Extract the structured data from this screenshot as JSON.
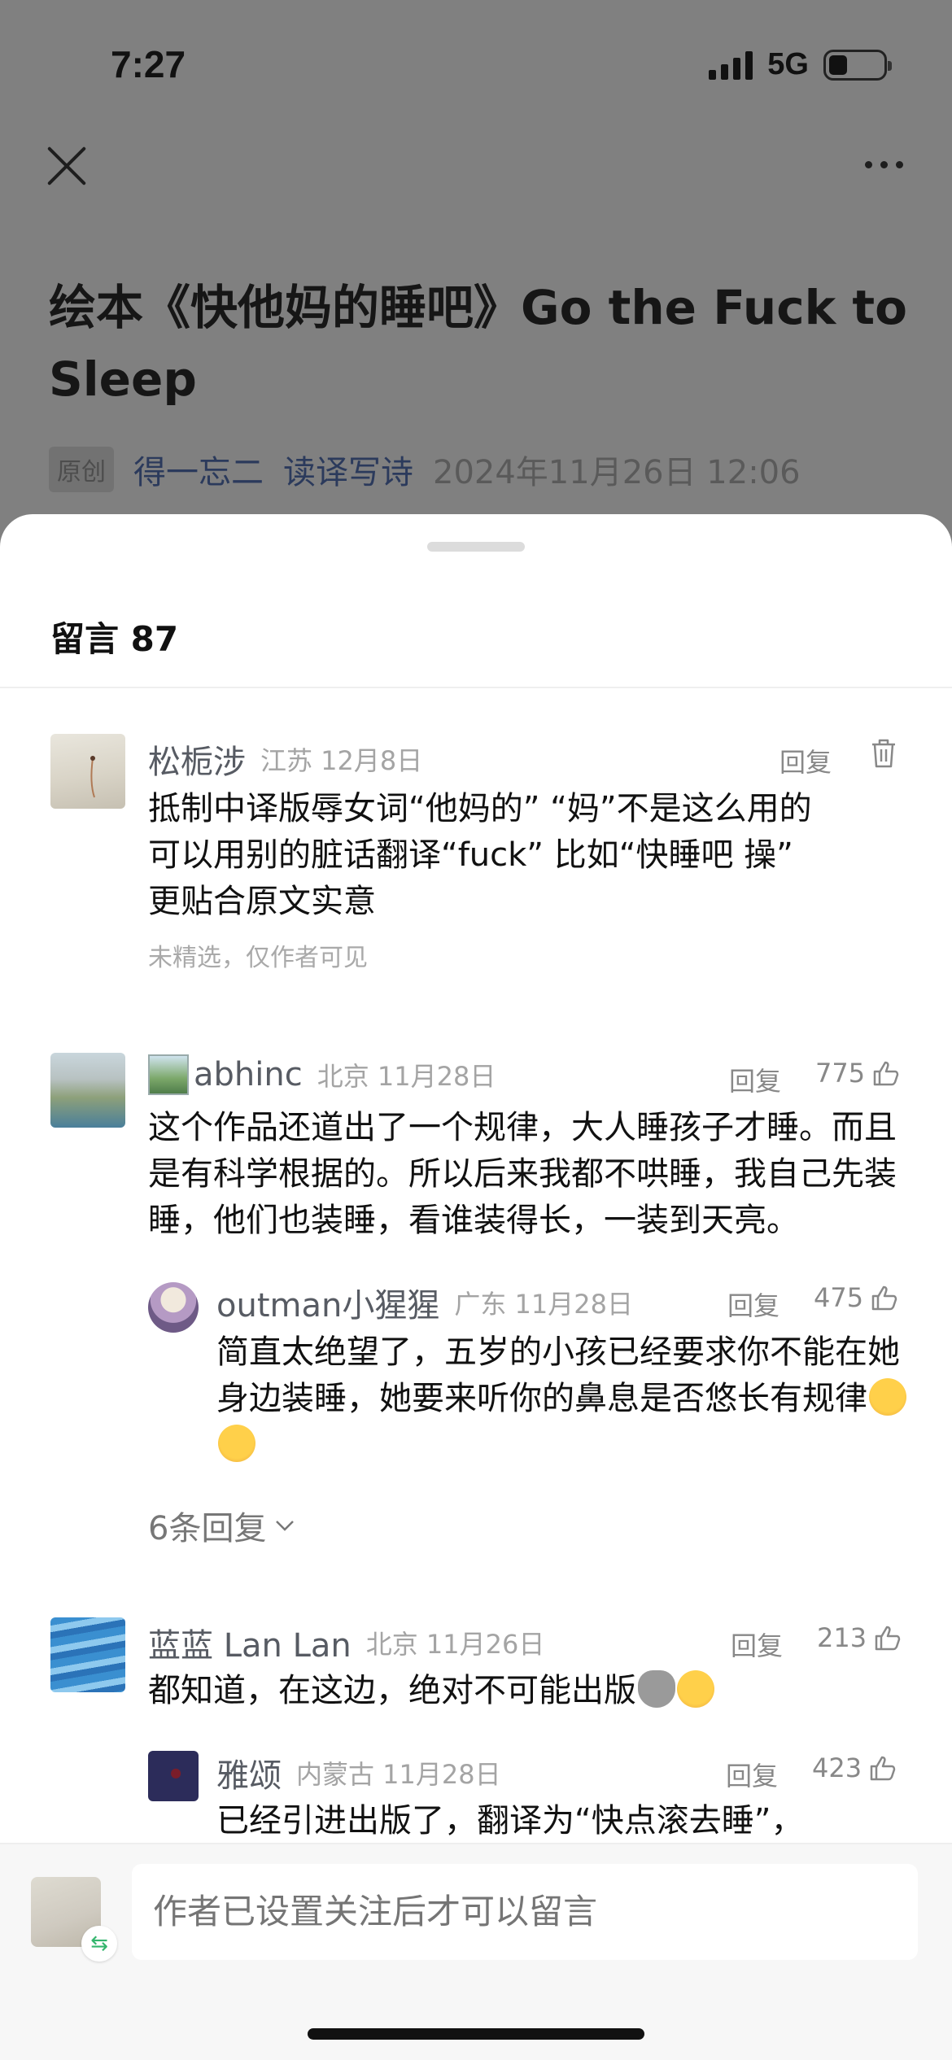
{
  "status_bar": {
    "time": "7:27",
    "network": "5G"
  },
  "article": {
    "title": "绘本《快他妈的睡吧》Go the Fuck to Sleep",
    "badge": "原创",
    "author": "得一忘二",
    "column": "读译写诗",
    "date": "2024年11月26日 12:06"
  },
  "comments_sheet": {
    "header": "留言 87",
    "comments": [
      {
        "name": "松栀涉",
        "location": "江苏 12月8日",
        "reply_label": "回复",
        "text": "抵制中译版辱女词“他妈的” “妈”不是这么用的  可以用别的脏话翻译“fuck” 比如“快睡吧 操” 更贴合原文实意",
        "note": "未精选，仅作者可见"
      },
      {
        "name": "abhinc",
        "location": "北京 11月28日",
        "reply_label": "回复",
        "likes": "775",
        "text": "这个作品还道出了一个规律，大人睡孩子才睡。而且是有科学根据的。所以后来我都不哄睡，我自己先装睡，他们也装睡，看谁装得长，一装到天亮。",
        "reply": {
          "name": "outman小猩猩",
          "location": "广东 11月28日",
          "reply_label": "回复",
          "likes": "475",
          "text": "简直太绝望了，五岁的小孩已经要求你不能在她身边装睡，她要来听你的鼻息是否悠长有规律"
        },
        "more_replies": "6条回复"
      },
      {
        "name": "蓝蓝 Lan Lan",
        "location": "北京 11月26日",
        "reply_label": "回复",
        "likes": "213",
        "text": "都知道，在这边，绝对不可能出版",
        "reply": {
          "name": "雅颂",
          "location": "内蒙古 11月28日",
          "reply_label": "回复",
          "likes": "423",
          "text": "已经引进出版了，翻译为“快点滚去睡”，"
        }
      }
    ]
  },
  "composer": {
    "placeholder": "作者已设置关注后才可以留言",
    "swap_icon": "⇆"
  }
}
